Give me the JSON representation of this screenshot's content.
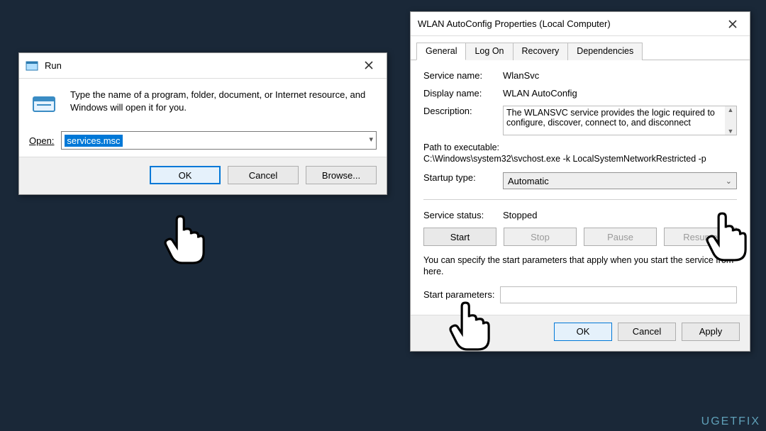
{
  "run": {
    "title": "Run",
    "message": "Type the name of a program, folder, document, or Internet resource, and Windows will open it for you.",
    "open_label": "Open:",
    "open_value": "services.msc",
    "buttons": {
      "ok": "OK",
      "cancel": "Cancel",
      "browse": "Browse..."
    }
  },
  "props": {
    "title": "WLAN AutoConfig Properties (Local Computer)",
    "tabs": [
      "General",
      "Log On",
      "Recovery",
      "Dependencies"
    ],
    "active_tab": 0,
    "fields": {
      "service_name_label": "Service name:",
      "service_name": "WlanSvc",
      "display_name_label": "Display name:",
      "display_name": "WLAN AutoConfig",
      "description_label": "Description:",
      "description": "The WLANSVC service provides the logic required to configure, discover, connect to, and disconnect",
      "path_label": "Path to executable:",
      "path": "C:\\Windows\\system32\\svchost.exe -k LocalSystemNetworkRestricted -p",
      "startup_label": "Startup type:",
      "startup_value": "Automatic",
      "status_label": "Service status:",
      "status_value": "Stopped"
    },
    "svc_buttons": {
      "start": "Start",
      "stop": "Stop",
      "pause": "Pause",
      "resume": "Resume"
    },
    "hint": "You can specify the start parameters that apply when you start the service from here.",
    "param_label": "Start parameters:",
    "param_value": "",
    "buttons": {
      "ok": "OK",
      "cancel": "Cancel",
      "apply": "Apply"
    }
  },
  "watermark": "UGETFIX"
}
